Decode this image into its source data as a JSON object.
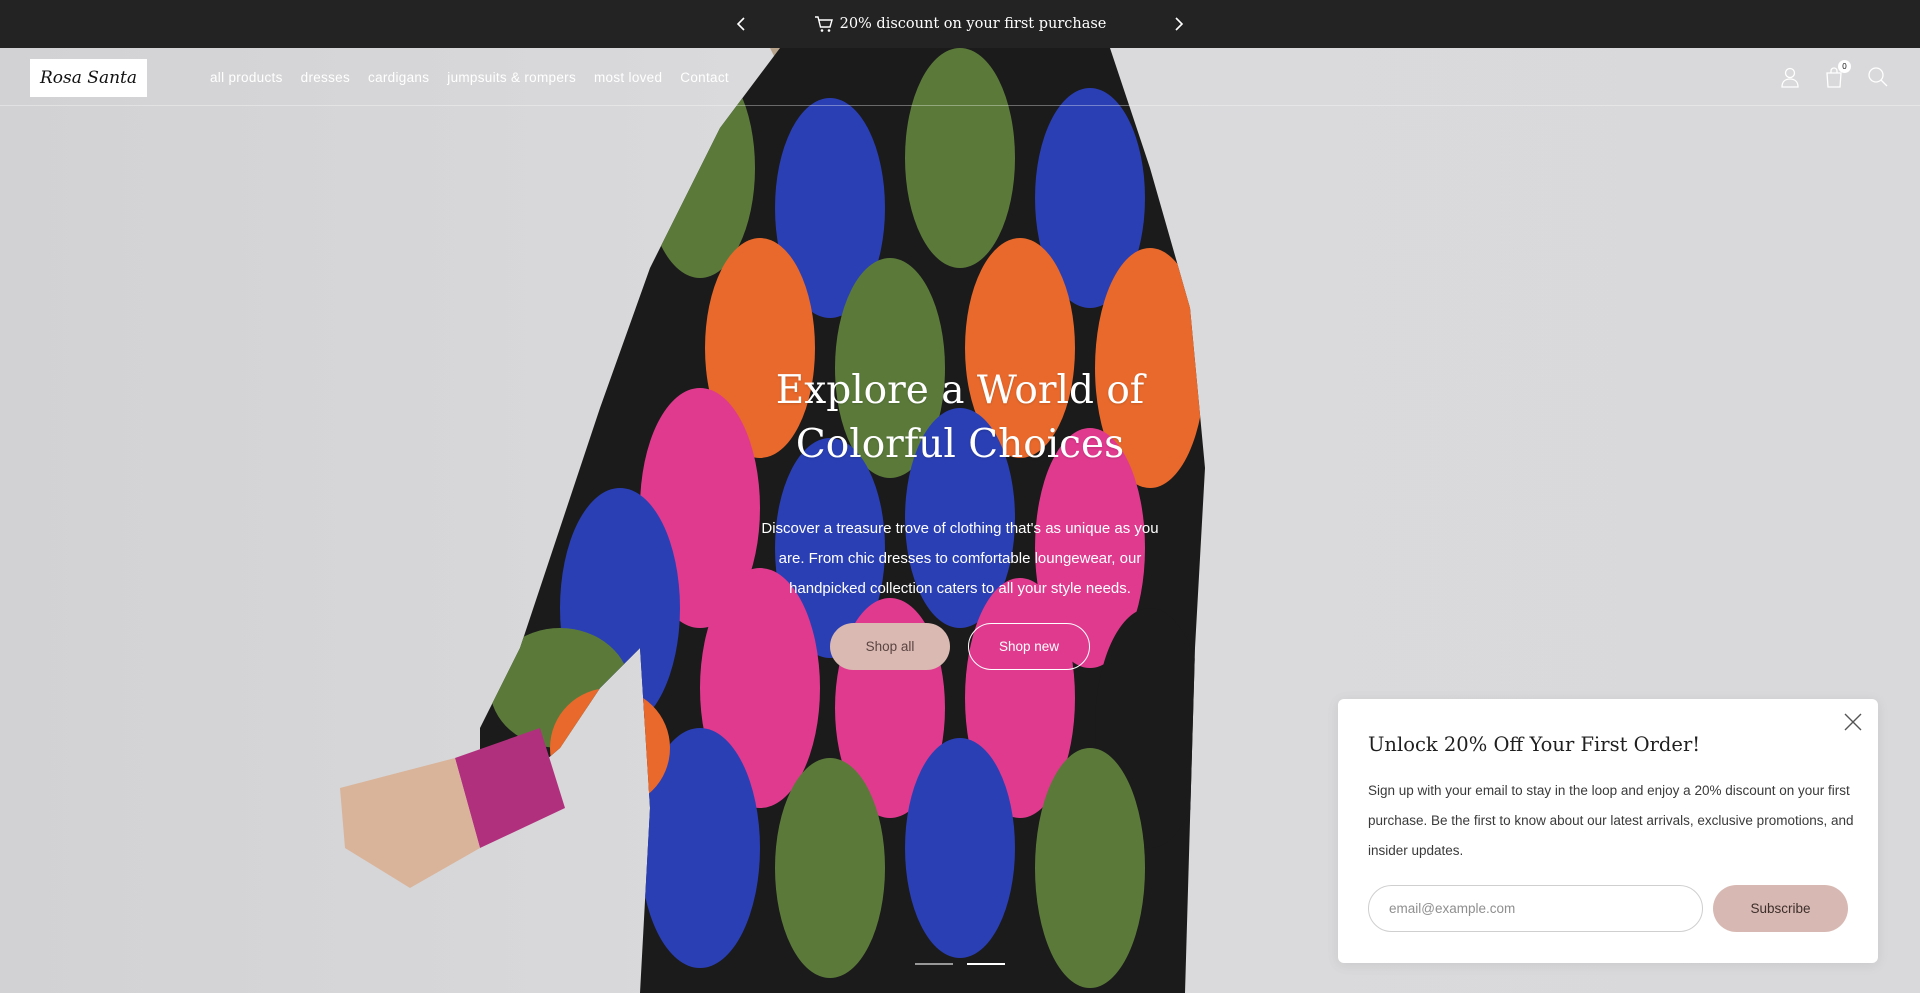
{
  "announcement": {
    "text": "20% discount on your first purchase",
    "icon": "cart-icon"
  },
  "brand": {
    "logo_text": "Rosa Santa"
  },
  "nav": {
    "items": [
      {
        "label": "all products"
      },
      {
        "label": "dresses"
      },
      {
        "label": "cardigans"
      },
      {
        "label": "jumpsuits & rompers"
      },
      {
        "label": "most loved"
      },
      {
        "label": "Contact"
      }
    ]
  },
  "header_icons": {
    "account": "user-icon",
    "cart": "bag-icon",
    "cart_count": "0",
    "search": "search-icon"
  },
  "hero": {
    "title_line1": "Explore a World of",
    "title_line2": "Colorful Choices",
    "description": "Discover a treasure trove of clothing that's as unique as you are. From chic dresses to comfortable loungewear, our handpicked collection caters to all your style needs.",
    "button_primary": "Shop all",
    "button_secondary": "Shop new",
    "slides_total": 2,
    "active_slide": 2
  },
  "popup": {
    "title": "Unlock 20% Off Your First Order!",
    "body": "Sign up with your email to stay in the loop and enjoy a 20% discount on your first purchase. Be the first to know about our latest arrivals, exclusive promotions, and insider updates.",
    "email_placeholder": "email@example.com",
    "subscribe_label": "Subscribe"
  },
  "colors": {
    "announcement_bg": "#232323",
    "accent": "#dbb9b3",
    "hero_bg": "#d6d6d8"
  }
}
